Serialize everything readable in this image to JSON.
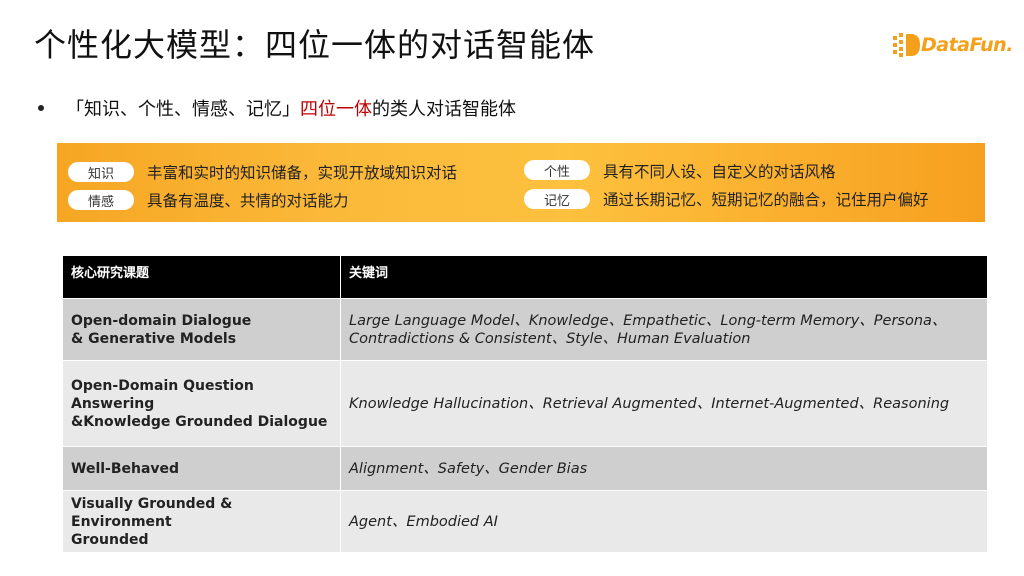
{
  "slide": {
    "title": "个性化大模型：四位一体的对话智能体",
    "logo_text": "DataFun.",
    "bullet": {
      "part1": "「知识、个性、情感、记忆」",
      "highlight": "四位一体",
      "part2": "的类人对话智能体"
    },
    "banner": {
      "items": [
        {
          "tag": "知识",
          "text": "丰富和实时的知识储备，实现开放域知识对话"
        },
        {
          "tag": "情感",
          "text": "具备有温度、共情的对话能力"
        },
        {
          "tag": "个性",
          "text": "具有不同人设、自定义的对话风格"
        },
        {
          "tag": "记忆",
          "text": "通过长期记忆、短期记忆的融合，记住用户偏好"
        }
      ]
    },
    "table": {
      "headers": [
        "核心研究课题",
        "关键词"
      ],
      "rows": [
        {
          "topic_lines": [
            "Open-domain Dialogue",
            "& Generative Models"
          ],
          "keyword_lines": [
            "Large Language Model、Knowledge、Empathetic、Long-term Memory、Persona、",
            "Contradictions & Consistent、Style、Human Evaluation"
          ]
        },
        {
          "topic_lines": [
            "Open-Domain Question",
            "Answering",
            "&Knowledge Grounded Dialogue"
          ],
          "keyword_lines": [
            "Knowledge Hallucination、Retrieval Augmented、Internet-Augmented、Reasoning"
          ]
        },
        {
          "topic_lines": [
            "Well-Behaved"
          ],
          "keyword_lines": [
            "Alignment、Safety、Gender Bias"
          ]
        },
        {
          "topic_lines": [
            "Visually Grounded & Environment",
            "Grounded"
          ],
          "keyword_lines": [
            "Agent、Embodied AI"
          ]
        }
      ]
    },
    "colors": {
      "accent_red": "#c00000",
      "banner_orange": "#f7a01f",
      "logo_orange": "#f5a01a",
      "header_black": "#000000"
    }
  }
}
